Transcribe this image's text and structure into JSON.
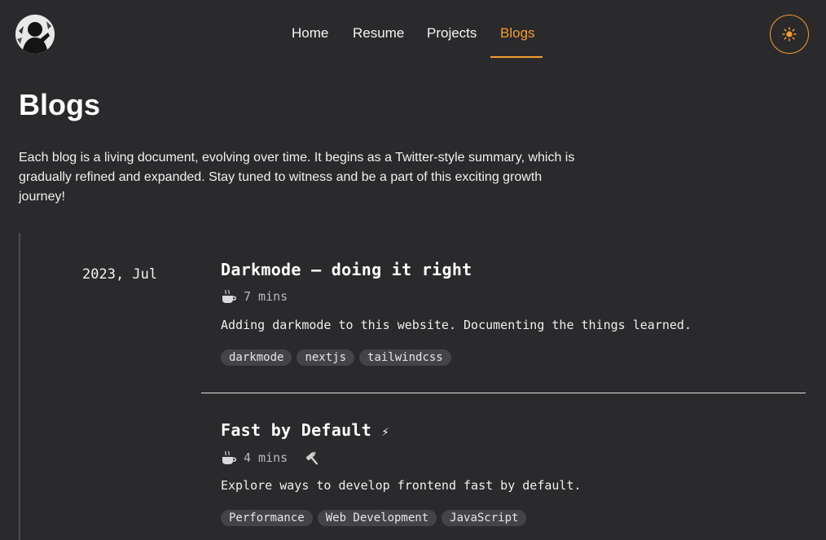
{
  "nav": {
    "items": [
      {
        "label": "Home",
        "active": false
      },
      {
        "label": "Resume",
        "active": false
      },
      {
        "label": "Projects",
        "active": false
      },
      {
        "label": "Blogs",
        "active": true
      }
    ]
  },
  "header": {
    "avatar_icon": "profile-avatar",
    "theme_toggle_icon": "sun-icon"
  },
  "page": {
    "title": "Blogs",
    "intro": "Each blog is a living document, evolving over time. It begins as a Twitter-style summary, which is gradually refined and expanded. Stay tuned to witness and be a part of this exciting growth journey!"
  },
  "timeline": {
    "groups": [
      {
        "date": "2023, Jul",
        "posts": [
          {
            "title": "Darkmode – doing it right",
            "read_time": "7 mins",
            "description": "Adding darkmode to this website. Documenting the things learned.",
            "tags": [
              "darkmode",
              "nextjs",
              "tailwindcss"
            ]
          },
          {
            "title": "Fast by Default",
            "title_icon": "⚡",
            "read_time": "4 mins",
            "status_icon": "🔨",
            "description": "Explore ways to develop frontend fast by default.",
            "tags": [
              "Performance",
              "Web Development",
              "JavaScript"
            ]
          }
        ]
      }
    ]
  },
  "colors": {
    "background": "#2a2a2c",
    "accent": "#f39c2f",
    "tag_background": "#444448",
    "muted_text": "#b9b9bf"
  }
}
